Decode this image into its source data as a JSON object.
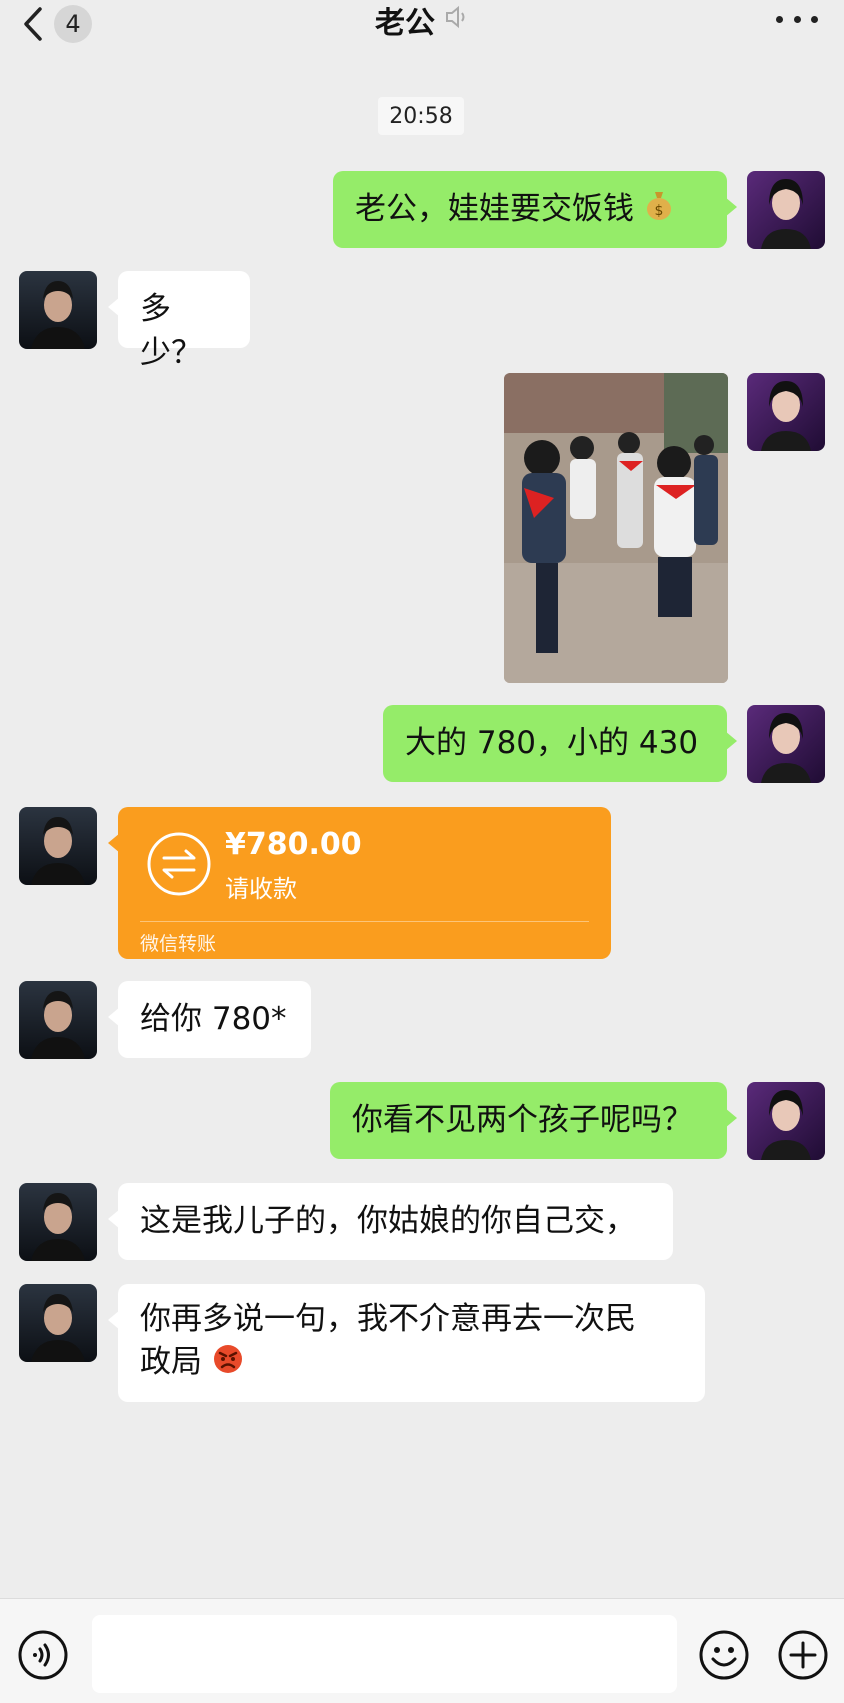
{
  "header": {
    "back_icon": "chevron-left-icon",
    "unread_count": "4",
    "title": "老公",
    "mute_icon": "muted-speaker-icon",
    "more_icon": "ellipsis-icon"
  },
  "chat": {
    "timestamp": "20:58",
    "messages": [
      {
        "sender": "me",
        "type": "text",
        "text": "老公，娃娃要交饭钱",
        "emoji": "money-bag"
      },
      {
        "sender": "them",
        "type": "text",
        "text": "多少？"
      },
      {
        "sender": "me",
        "type": "image",
        "description_icon": "photo-image"
      },
      {
        "sender": "me",
        "type": "text",
        "text": "大的 780，小的 430"
      },
      {
        "sender": "them",
        "type": "transfer",
        "amount": "¥780.00",
        "status": "请收款",
        "label": "微信转账"
      },
      {
        "sender": "them",
        "type": "text",
        "text": "给你 780*"
      },
      {
        "sender": "me",
        "type": "text",
        "text": "你看不见两个孩子呢吗？"
      },
      {
        "sender": "them",
        "type": "text",
        "text": "这是我儿子的，你姑娘的你自己交，"
      },
      {
        "sender": "them",
        "type": "text",
        "line1": "你再多说一句，我不介意再去一次民",
        "line2": "政局",
        "emoji": "angry-face"
      }
    ]
  },
  "input_bar": {
    "voice_icon": "voice-icon",
    "input_value": "",
    "emoji_icon": "smiley-icon",
    "plus_icon": "plus-icon"
  },
  "colors": {
    "background": "#ededed",
    "my_bubble": "#95ec69",
    "their_bubble": "#ffffff",
    "transfer": "#fa9d1e"
  }
}
